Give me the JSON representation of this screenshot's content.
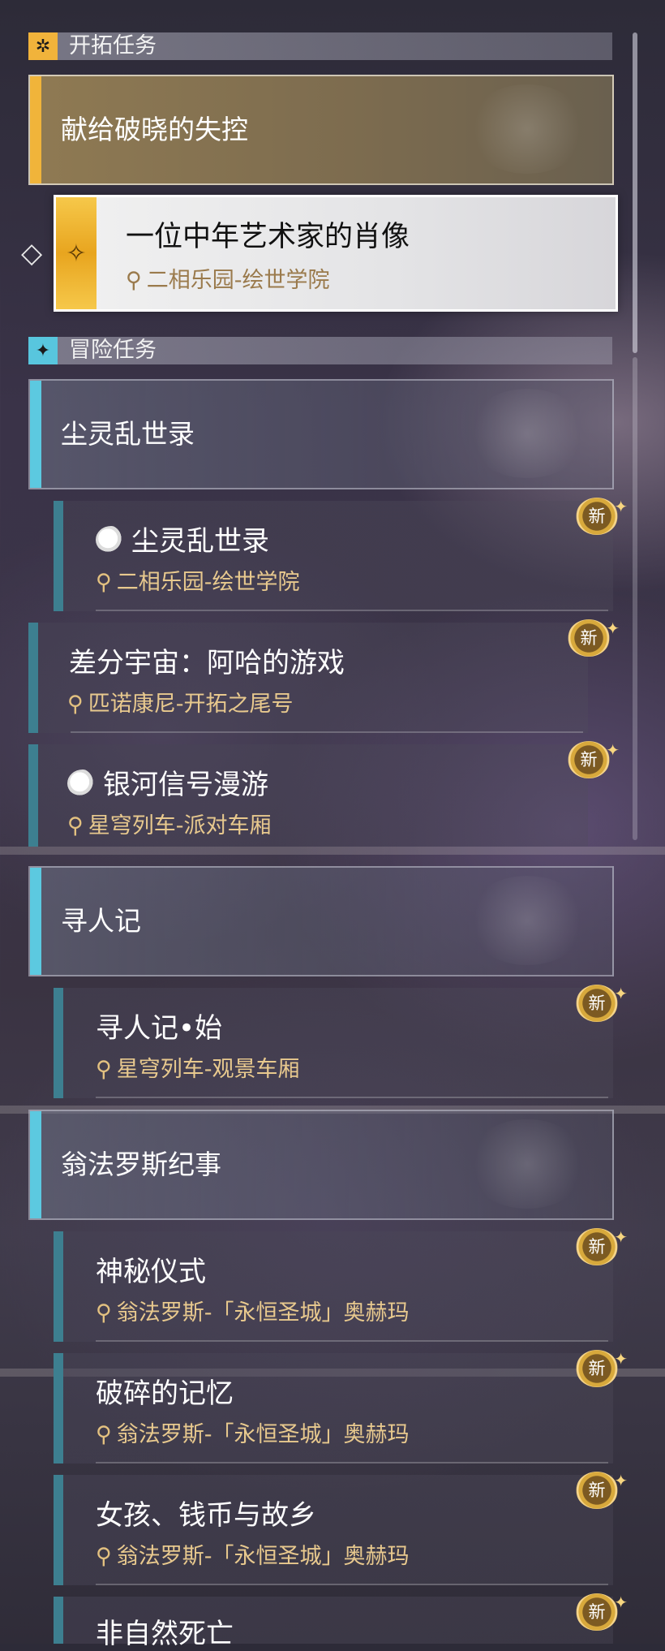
{
  "categories": {
    "trailblaze": {
      "title": "开拓任务",
      "icon": "trailblaze-icon"
    },
    "adventure": {
      "title": "冒险任务",
      "icon": "adventure-icon"
    }
  },
  "trailblaze_group": {
    "title": "献给破晓的失控"
  },
  "selected_quest": {
    "title": "一位中年艺术家的肖像",
    "location": "二相乐园-绘世学院"
  },
  "groups": [
    {
      "title": "尘灵乱世录",
      "quests": [
        {
          "title": "尘灵乱世录",
          "location": "二相乐园-绘世学院",
          "badge": "新",
          "icon": "spirit-icon"
        },
        {
          "title": "差分宇宙：阿哈的游戏",
          "location": "匹诺康尼-开拓之尾号",
          "badge": "新"
        },
        {
          "title": "银河信号漫游",
          "location": "星穹列车-派对车厢",
          "badge": "新",
          "icon": "spirit-icon"
        }
      ]
    },
    {
      "title": "寻人记",
      "quests": [
        {
          "title": "寻人记•始",
          "location": "星穹列车-观景车厢",
          "badge": "新"
        }
      ]
    },
    {
      "title": "翁法罗斯纪事",
      "quests": [
        {
          "title": "神秘仪式",
          "location": "翁法罗斯-「永恒圣城」奥赫玛",
          "badge": "新"
        },
        {
          "title": "破碎的记忆",
          "location": "翁法罗斯-「永恒圣城」奥赫玛",
          "badge": "新"
        },
        {
          "title": "女孩、钱币与故乡",
          "location": "翁法罗斯-「永恒圣城」奥赫玛",
          "badge": "新"
        },
        {
          "title": "非自然死亡",
          "location": "",
          "badge": "新"
        }
      ]
    }
  ],
  "colors": {
    "gold_accent": "#f0b43a",
    "cyan_accent": "#5cc9e0",
    "teal_bar": "#3d7f90",
    "location_text": "#e8c98e"
  }
}
